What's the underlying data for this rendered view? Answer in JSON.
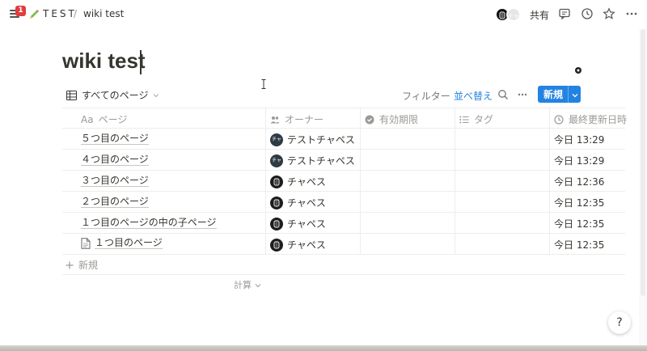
{
  "topbar": {
    "notification_count": "1",
    "workspace": "TEST",
    "separator": "/",
    "page": "wiki test",
    "avatar_initials": "チャ",
    "share_label": "共有",
    "icons": [
      "menu-icon",
      "pencil-icon",
      "comment-icon",
      "clock-icon",
      "star-icon",
      "more-icon"
    ]
  },
  "page": {
    "title": "wiki test"
  },
  "view": {
    "name": "すべてのページ",
    "filter_label": "フィルター",
    "sort_label": "並べ替え",
    "new_label": "新規"
  },
  "table": {
    "columns": [
      "ページ",
      "オーナー",
      "有効期限",
      "タグ",
      "最終更新日時"
    ],
    "column_prefix": "Aa",
    "rows": [
      {
        "name": "５つ目のページ",
        "owner": "テストチャペス",
        "owner_avatar": "チャ",
        "updated": "今日 13:29"
      },
      {
        "name": "４つ目のページ",
        "owner": "テストチャペス",
        "owner_avatar": "チャ",
        "updated": "今日 13:29"
      },
      {
        "name": "３つ目のページ",
        "owner": "チャペス",
        "owner_avatar": "",
        "updated": "今日 12:36"
      },
      {
        "name": "２つ目のページ",
        "owner": "チャペス",
        "owner_avatar": "",
        "updated": "今日 12:35"
      },
      {
        "name": "１つ目のページの中の子ページ",
        "owner": "チャペス",
        "owner_avatar": "",
        "updated": "今日 12:35"
      },
      {
        "name": "１つ目のページ",
        "owner": "チャペス",
        "owner_avatar": "",
        "updated": "今日 12:35"
      }
    ],
    "add_row_label": "新規",
    "calc_label": "計算"
  },
  "help_label": "?",
  "colors": {
    "accent": "#2383e2",
    "badge": "#e03e3e",
    "text": "#37352f",
    "muted": "#9b9a97"
  }
}
